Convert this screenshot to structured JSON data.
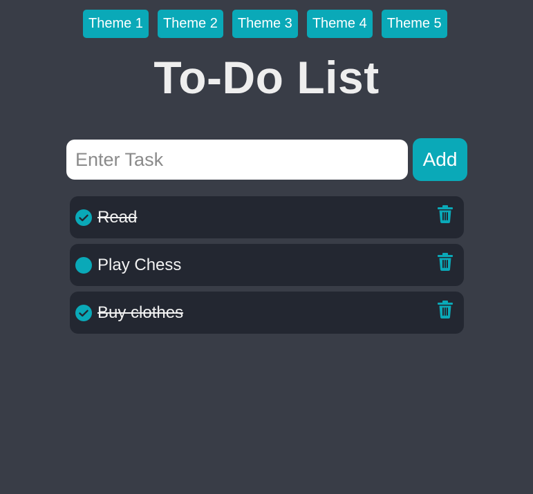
{
  "themes": {
    "items": [
      {
        "label": "Theme 1"
      },
      {
        "label": "Theme 2"
      },
      {
        "label": "Theme 3"
      },
      {
        "label": "Theme 4"
      },
      {
        "label": "Theme 5"
      }
    ]
  },
  "header": {
    "title": "To-Do List"
  },
  "form": {
    "input_placeholder": "Enter Task",
    "input_value": "",
    "add_label": "Add"
  },
  "tasks": [
    {
      "label": "Read",
      "completed": true
    },
    {
      "label": "Play Chess",
      "completed": false
    },
    {
      "label": "Buy clothes",
      "completed": true
    }
  ],
  "icons": {
    "completed_state": "check-circle-icon",
    "pending_state": "circle-icon",
    "delete": "trash-icon"
  },
  "colors": {
    "background": "#393d47",
    "accent": "#0aa9b8",
    "task_background": "#232731",
    "title": "#eeeeee",
    "input_background": "#ffffff"
  }
}
